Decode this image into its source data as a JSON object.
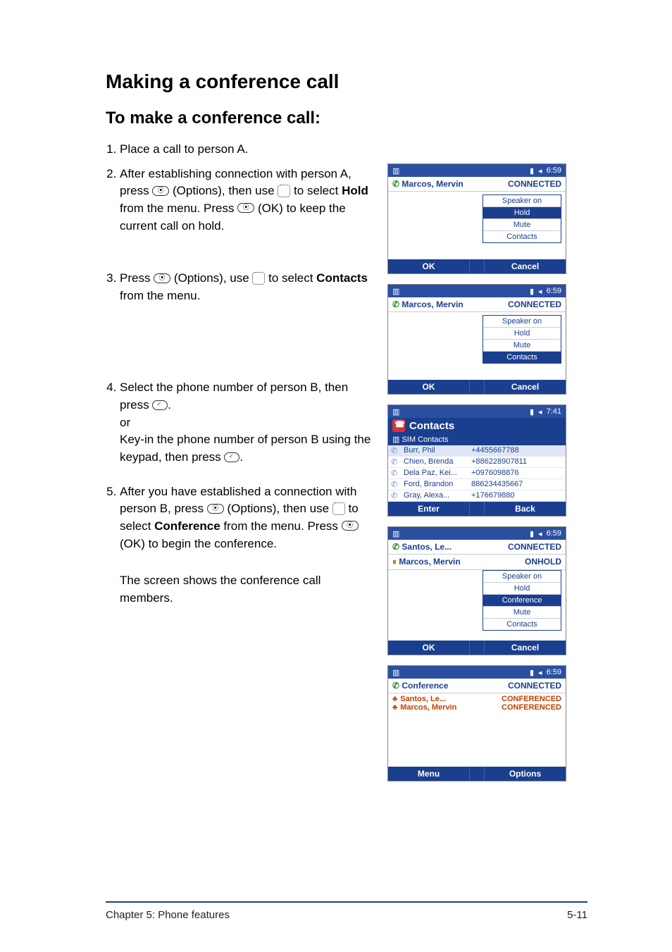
{
  "title": "Making a conference call",
  "subtitle": "To make a conference call:",
  "steps": {
    "s1": "Place a call to person A.",
    "s2a": "After establishing connection with person A, press ",
    "s2b": " (Options), then use ",
    "s2c": " to select ",
    "s2_hold": "Hold",
    "s2d": " from the menu. Press ",
    "s2e": " (OK) to keep the current call on hold.",
    "s3a": "Press ",
    "s3b": " (Options), use ",
    "s3c": " to select ",
    "s3_contacts": "Contacts",
    "s3d": " from the menu.",
    "s4a": "Select the phone number of person B, then press ",
    "s4b": ".",
    "s4_or": "or",
    "s4c": "Key-in the phone number of person B using the keypad, then press ",
    "s4d": ".",
    "s5a": "After you have established a connection with person B, press ",
    "s5b": " (Options), then use ",
    "s5c": " to select ",
    "s5_conf": "Conference",
    "s5d": " from the menu. Press ",
    "s5e": " (OK) to begin the conference.",
    "s_final": "The screen shows the conference call members."
  },
  "shot_common": {
    "time": "6:59",
    "caller": "Marcos, Mervin",
    "status_connected": "CONNECTED",
    "ok": "OK",
    "cancel": "Cancel"
  },
  "menu_items": {
    "speaker": "Speaker on",
    "hold": "Hold",
    "mute": "Mute",
    "contacts": "Contacts",
    "conference": "Conference"
  },
  "shot_contacts": {
    "time": "7:41",
    "title": "Contacts",
    "subtitle": "SIM Contacts",
    "enter": "Enter",
    "back": "Back",
    "rows": [
      {
        "name": "Burr, Phil",
        "num": "+4455667788"
      },
      {
        "name": "Chien, Brenda",
        "num": "+886228907811"
      },
      {
        "name": "Dela Paz, Kei...",
        "num": "+0976098876"
      },
      {
        "name": "Ford, Brandon",
        "num": "886234435667"
      },
      {
        "name": "Gray, Alexa...",
        "num": "+176679880"
      }
    ]
  },
  "shot_conf_menu": {
    "santos": "Santos, Le...",
    "santos_status": "CONNECTED",
    "marcos": "Marcos, Mervin",
    "marcos_status": "ONHOLD"
  },
  "shot_members": {
    "conf": "Conference",
    "conf_status": "CONNECTED",
    "santos": "Santos, Le...",
    "santos_status": "CONFERENCED",
    "marcos": "Marcos, Mervin",
    "marcos_status": "CONFERENCED",
    "menu": "Menu",
    "options": "Options"
  },
  "footer": {
    "chapter": "Chapter 5: Phone features",
    "page": "5-11"
  }
}
